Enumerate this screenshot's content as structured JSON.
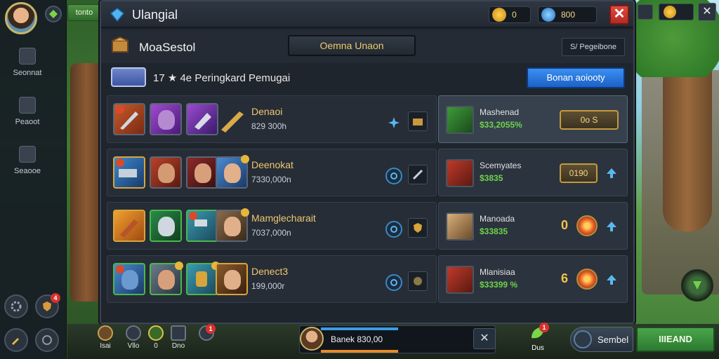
{
  "world_tab": "tonto",
  "window": {
    "title": "Ulangial",
    "currency_gold": "0",
    "currency_gems": "800",
    "close_label": "✕"
  },
  "sub": {
    "title": "MoaSestol",
    "center_button": "Oemna Unaon",
    "right_link": "S/ Pegeibone"
  },
  "filter": {
    "counts": "17 ★ 4e",
    "label": "Peringkard Pemugai",
    "blue_button": "Bonan aoiooty"
  },
  "rows": [
    {
      "name": "Denaoi",
      "amount": "829 300h",
      "opponent": "Mashenad",
      "opp_value": "$33,2055%",
      "pill": "0o    S"
    },
    {
      "name": "Deenokat",
      "amount": "7330,000n",
      "opponent": "Scemyates",
      "opp_value": "$3835",
      "pill": "0190"
    },
    {
      "name": "Mamglecharait",
      "amount": "7037,000n",
      "opponent": "Manoada",
      "opp_value": "$33835",
      "num": "0"
    },
    {
      "name": "Denect3",
      "amount": "199,000r",
      "opponent": "Mlanisiaa",
      "opp_value": "$33399 %",
      "num": "6"
    }
  ],
  "rail": {
    "item1": "Seonnat",
    "item2": "Peaoot",
    "item3": "Seaooe",
    "badge": "4"
  },
  "bottom": {
    "items": [
      "Isai",
      "Vllo",
      "0",
      "Dno"
    ],
    "badge": "1",
    "progress_text": "Banek 830,00",
    "chat_label": "Dus",
    "chat_badge": "1",
    "search_label": "Sembel",
    "green_button": "IIIEAND"
  },
  "colors": {
    "accent_gold": "#f0c76e",
    "value_green": "#6fd24a",
    "primary_blue": "#1c62c8",
    "close_red": "#e24a3d"
  }
}
